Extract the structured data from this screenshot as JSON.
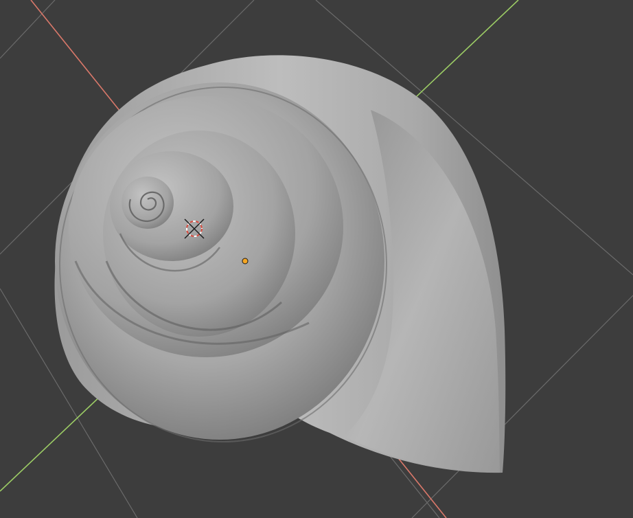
{
  "viewport": {
    "background_color": "#3d3d3d",
    "grid_line_color": "#6b6b6b",
    "x_axis_color": "#d9786a",
    "y_axis_color": "#9ccc65",
    "mesh_color": "#a9a9a9"
  },
  "scene": {
    "object": "snail-shell-mesh",
    "origin_marker_color": "#f5a623",
    "cursor_color_primary": "#d94a3e",
    "cursor_color_secondary": "#ffffff"
  }
}
